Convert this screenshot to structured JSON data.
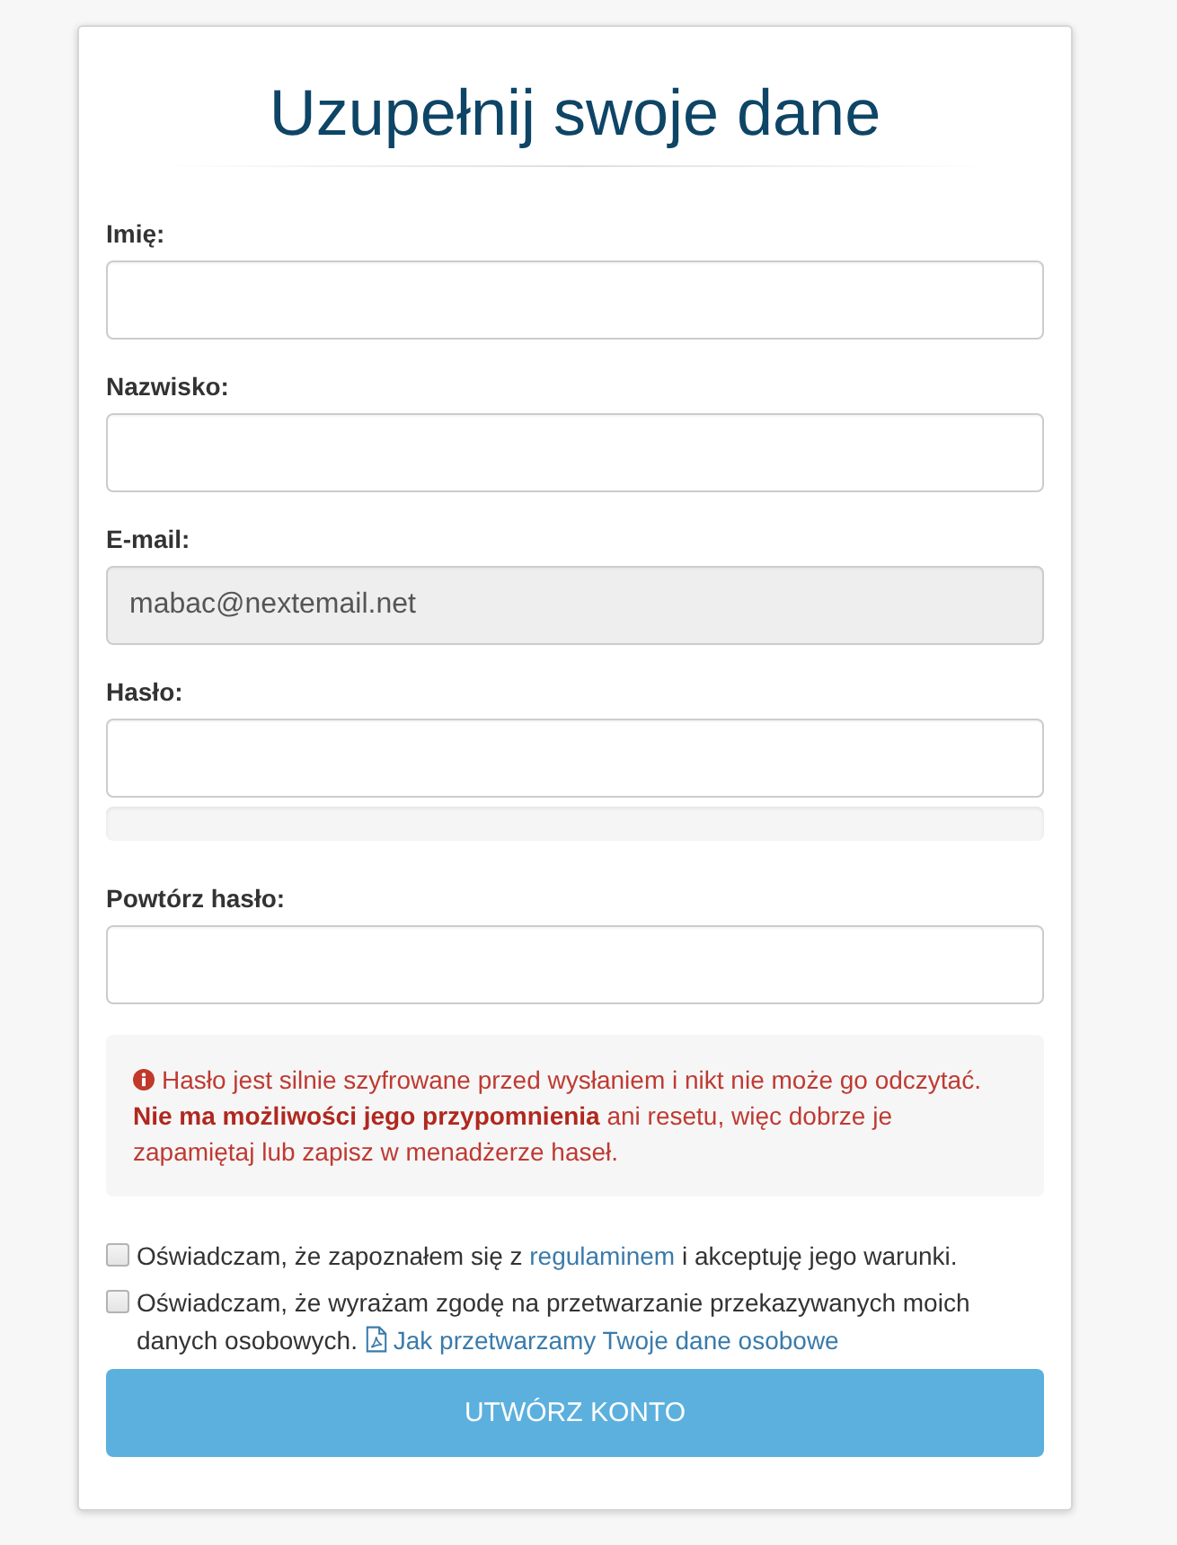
{
  "title": "Uzupełnij swoje dane",
  "fields": [
    {
      "kind": "plain",
      "label": "Imię:",
      "disabled": false
    },
    {
      "kind": "plain",
      "label": "Nazwisko:",
      "disabled": false
    },
    {
      "kind": "plain",
      "label": "E-mail:",
      "value": "mabac@nextemail.net",
      "disabled": true
    },
    {
      "kind": "with_strength_meter",
      "label": "Hasło:",
      "disabled": false
    },
    {
      "kind": "plain",
      "label": "Powtórz hasło:",
      "disabled": false
    }
  ],
  "password_notice": {
    "sentences": [
      "Hasło jest silnie szyfrowane przed wysłaniem i nikt nie może go odczytać.",
      "**Nie ma możliwości jego przypomnienia** ani resetu, więc dobrze je zapamiętaj lub zapisz w menadżerze haseł."
    ]
  },
  "consents": [
    {
      "kind": "inline_link",
      "checked": false,
      "text_before": "Oświadczam, że zapoznałem się z",
      "link": "regulaminem",
      "text_after": "i akceptuję jego warunki."
    },
    {
      "kind": "document_link",
      "checked": false,
      "text": "Oświadczam, że wyrażam zgodę na przetwarzanie przekazywanych moich danych osobowych.",
      "link": "Jak przetwarzamy Twoje dane osobowe"
    }
  ],
  "submit_button": "UTWÓRZ KONTO"
}
